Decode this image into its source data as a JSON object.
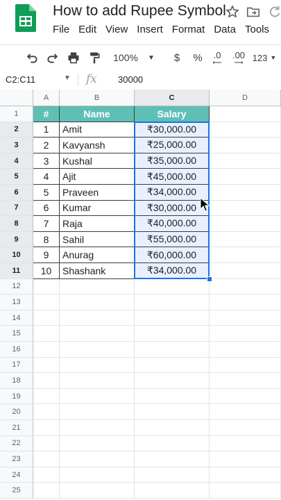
{
  "app": {
    "title": "How to add Rupee Symbol",
    "menu": [
      "File",
      "Edit",
      "View",
      "Insert",
      "Format",
      "Data",
      "Tools"
    ]
  },
  "toolbar": {
    "zoom": "100%",
    "currency": "$",
    "percent": "%",
    "dec_decrease": ".0",
    "dec_increase": ".00",
    "more_formats": "123"
  },
  "formula_bar": {
    "name_box": "C2:C11",
    "fx": "fx",
    "value": "30000"
  },
  "columns": [
    "A",
    "B",
    "C",
    "D"
  ],
  "rows": [
    "1",
    "2",
    "3",
    "4",
    "5",
    "6",
    "7",
    "8",
    "9",
    "10",
    "11",
    "12",
    "13",
    "14",
    "15",
    "16",
    "17",
    "18",
    "19",
    "20",
    "21",
    "22",
    "23",
    "24",
    "25"
  ],
  "table": {
    "headers": [
      "#",
      "Name",
      "Salary"
    ],
    "rows": [
      [
        "1",
        "Amit",
        "₹30,000.00"
      ],
      [
        "2",
        "Kavyansh",
        "₹25,000.00"
      ],
      [
        "3",
        "Kushal",
        "₹35,000.00"
      ],
      [
        "4",
        "Ajit",
        "₹45,000.00"
      ],
      [
        "5",
        "Praveen",
        "₹34,000.00"
      ],
      [
        "6",
        "Kumar",
        "₹30,000.00"
      ],
      [
        "7",
        "Raja",
        "₹40,000.00"
      ],
      [
        "8",
        "Sahil",
        "₹55,000.00"
      ],
      [
        "9",
        "Anurag",
        "₹60,000.00"
      ],
      [
        "10",
        "Shashank",
        "₹34,000.00"
      ]
    ]
  },
  "colors": {
    "header_fill": "#5fbfb5",
    "selection": "#1a73e8",
    "sheets_green": "#0f9d58"
  },
  "icons": [
    "sheets-logo-icon",
    "star-icon",
    "move-to-folder-icon",
    "sync-icon",
    "undo-icon",
    "redo-icon",
    "print-icon",
    "paint-format-icon",
    "fx-icon",
    "mouse-pointer-icon"
  ]
}
